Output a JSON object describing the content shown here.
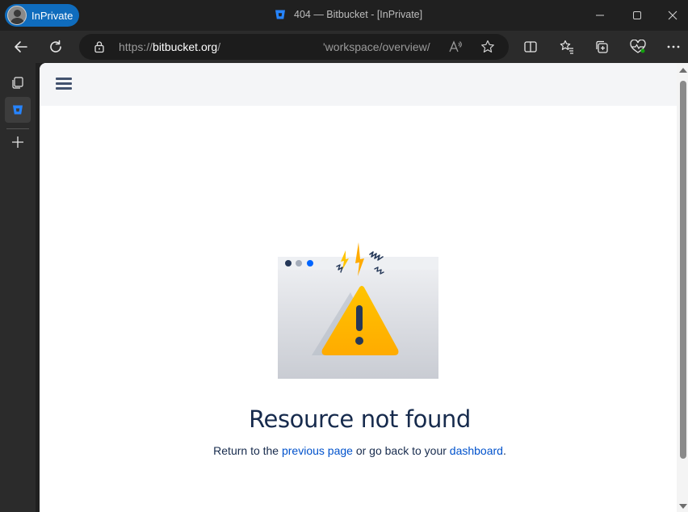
{
  "browser": {
    "profile_label": "InPrivate",
    "tab_title": "404 — Bitbucket - [InPrivate]",
    "url_scheme": "https://",
    "url_host": "bitbucket.org",
    "url_slash": "/",
    "url_path": "'workspace/overview/"
  },
  "page": {
    "heading": "Resource not found",
    "message_prefix": "Return to the ",
    "previous_link": "previous page",
    "message_middle": " or go back to your ",
    "dashboard_link": "dashboard",
    "message_suffix": "."
  },
  "colors": {
    "brand_blue": "#0052cc",
    "heading": "#172b4d",
    "warning": "#ffab00",
    "inprivate": "#0f6cbd"
  }
}
